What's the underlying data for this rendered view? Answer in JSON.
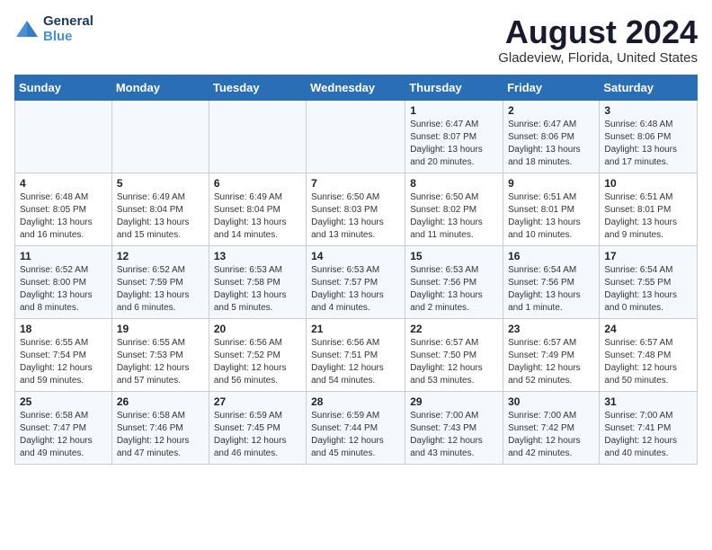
{
  "logo": {
    "line1": "General",
    "line2": "Blue"
  },
  "title": "August 2024",
  "subtitle": "Gladeview, Florida, United States",
  "weekdays": [
    "Sunday",
    "Monday",
    "Tuesday",
    "Wednesday",
    "Thursday",
    "Friday",
    "Saturday"
  ],
  "weeks": [
    [
      {
        "day": "",
        "info": ""
      },
      {
        "day": "",
        "info": ""
      },
      {
        "day": "",
        "info": ""
      },
      {
        "day": "",
        "info": ""
      },
      {
        "day": "1",
        "info": "Sunrise: 6:47 AM\nSunset: 8:07 PM\nDaylight: 13 hours\nand 20 minutes."
      },
      {
        "day": "2",
        "info": "Sunrise: 6:47 AM\nSunset: 8:06 PM\nDaylight: 13 hours\nand 18 minutes."
      },
      {
        "day": "3",
        "info": "Sunrise: 6:48 AM\nSunset: 8:06 PM\nDaylight: 13 hours\nand 17 minutes."
      }
    ],
    [
      {
        "day": "4",
        "info": "Sunrise: 6:48 AM\nSunset: 8:05 PM\nDaylight: 13 hours\nand 16 minutes."
      },
      {
        "day": "5",
        "info": "Sunrise: 6:49 AM\nSunset: 8:04 PM\nDaylight: 13 hours\nand 15 minutes."
      },
      {
        "day": "6",
        "info": "Sunrise: 6:49 AM\nSunset: 8:04 PM\nDaylight: 13 hours\nand 14 minutes."
      },
      {
        "day": "7",
        "info": "Sunrise: 6:50 AM\nSunset: 8:03 PM\nDaylight: 13 hours\nand 13 minutes."
      },
      {
        "day": "8",
        "info": "Sunrise: 6:50 AM\nSunset: 8:02 PM\nDaylight: 13 hours\nand 11 minutes."
      },
      {
        "day": "9",
        "info": "Sunrise: 6:51 AM\nSunset: 8:01 PM\nDaylight: 13 hours\nand 10 minutes."
      },
      {
        "day": "10",
        "info": "Sunrise: 6:51 AM\nSunset: 8:01 PM\nDaylight: 13 hours\nand 9 minutes."
      }
    ],
    [
      {
        "day": "11",
        "info": "Sunrise: 6:52 AM\nSunset: 8:00 PM\nDaylight: 13 hours\nand 8 minutes."
      },
      {
        "day": "12",
        "info": "Sunrise: 6:52 AM\nSunset: 7:59 PM\nDaylight: 13 hours\nand 6 minutes."
      },
      {
        "day": "13",
        "info": "Sunrise: 6:53 AM\nSunset: 7:58 PM\nDaylight: 13 hours\nand 5 minutes."
      },
      {
        "day": "14",
        "info": "Sunrise: 6:53 AM\nSunset: 7:57 PM\nDaylight: 13 hours\nand 4 minutes."
      },
      {
        "day": "15",
        "info": "Sunrise: 6:53 AM\nSunset: 7:56 PM\nDaylight: 13 hours\nand 2 minutes."
      },
      {
        "day": "16",
        "info": "Sunrise: 6:54 AM\nSunset: 7:56 PM\nDaylight: 13 hours\nand 1 minute."
      },
      {
        "day": "17",
        "info": "Sunrise: 6:54 AM\nSunset: 7:55 PM\nDaylight: 13 hours\nand 0 minutes."
      }
    ],
    [
      {
        "day": "18",
        "info": "Sunrise: 6:55 AM\nSunset: 7:54 PM\nDaylight: 12 hours\nand 59 minutes."
      },
      {
        "day": "19",
        "info": "Sunrise: 6:55 AM\nSunset: 7:53 PM\nDaylight: 12 hours\nand 57 minutes."
      },
      {
        "day": "20",
        "info": "Sunrise: 6:56 AM\nSunset: 7:52 PM\nDaylight: 12 hours\nand 56 minutes."
      },
      {
        "day": "21",
        "info": "Sunrise: 6:56 AM\nSunset: 7:51 PM\nDaylight: 12 hours\nand 54 minutes."
      },
      {
        "day": "22",
        "info": "Sunrise: 6:57 AM\nSunset: 7:50 PM\nDaylight: 12 hours\nand 53 minutes."
      },
      {
        "day": "23",
        "info": "Sunrise: 6:57 AM\nSunset: 7:49 PM\nDaylight: 12 hours\nand 52 minutes."
      },
      {
        "day": "24",
        "info": "Sunrise: 6:57 AM\nSunset: 7:48 PM\nDaylight: 12 hours\nand 50 minutes."
      }
    ],
    [
      {
        "day": "25",
        "info": "Sunrise: 6:58 AM\nSunset: 7:47 PM\nDaylight: 12 hours\nand 49 minutes."
      },
      {
        "day": "26",
        "info": "Sunrise: 6:58 AM\nSunset: 7:46 PM\nDaylight: 12 hours\nand 47 minutes."
      },
      {
        "day": "27",
        "info": "Sunrise: 6:59 AM\nSunset: 7:45 PM\nDaylight: 12 hours\nand 46 minutes."
      },
      {
        "day": "28",
        "info": "Sunrise: 6:59 AM\nSunset: 7:44 PM\nDaylight: 12 hours\nand 45 minutes."
      },
      {
        "day": "29",
        "info": "Sunrise: 7:00 AM\nSunset: 7:43 PM\nDaylight: 12 hours\nand 43 minutes."
      },
      {
        "day": "30",
        "info": "Sunrise: 7:00 AM\nSunset: 7:42 PM\nDaylight: 12 hours\nand 42 minutes."
      },
      {
        "day": "31",
        "info": "Sunrise: 7:00 AM\nSunset: 7:41 PM\nDaylight: 12 hours\nand 40 minutes."
      }
    ]
  ]
}
